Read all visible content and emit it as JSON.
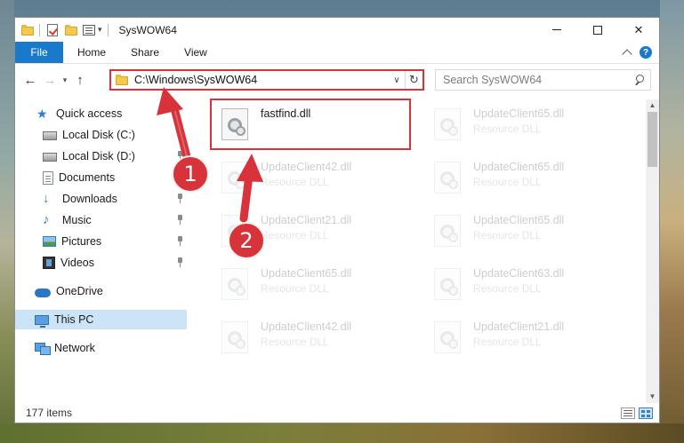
{
  "window": {
    "title": "SysWOW64",
    "qa_dropdown_glyph": "▾",
    "minimize_icon": "minimize-icon",
    "maximize_icon": "maximize-icon",
    "close_glyph": "✕"
  },
  "ribbon": {
    "tabs": [
      "File",
      "Home",
      "Share",
      "View"
    ],
    "help_glyph": "?"
  },
  "nav": {
    "back_glyph": "←",
    "forward_glyph": "→",
    "recent_glyph": "▾",
    "up_glyph": "↑",
    "address": "C:\\Windows\\SysWOW64",
    "address_drop_glyph": "∨",
    "refresh_glyph": "↻",
    "search_placeholder": "Search SysWOW64"
  },
  "sidebar": {
    "items": [
      {
        "label": "Quick access",
        "icon": "star-icon",
        "glyph": "★"
      },
      {
        "label": "Local Disk (C:)",
        "icon": "drive-icon"
      },
      {
        "label": "Local Disk (D:)",
        "icon": "drive-icon"
      },
      {
        "label": "Documents",
        "icon": "documents-icon"
      },
      {
        "label": "Downloads",
        "icon": "downloads-icon",
        "glyph": "↓"
      },
      {
        "label": "Music",
        "icon": "music-icon",
        "glyph": "♪"
      },
      {
        "label": "Pictures",
        "icon": "pictures-icon"
      },
      {
        "label": "Videos",
        "icon": "videos-icon"
      },
      {
        "label": "OneDrive",
        "icon": "onedrive-icon"
      },
      {
        "label": "This PC",
        "icon": "this-pc-icon"
      },
      {
        "label": "Network",
        "icon": "network-icon"
      }
    ]
  },
  "files": [
    {
      "name": "fastfind.dll",
      "type": ""
    },
    {
      "name": "UpdateClient65.dll",
      "type": "Resource DLL"
    },
    {
      "name": "UpdateClient42.dll",
      "type": "Resource DLL"
    },
    {
      "name": "UpdateClient65.dll",
      "type": "Resource DLL"
    },
    {
      "name": "UpdateClient21.dll",
      "type": "Resource DLL"
    },
    {
      "name": "UpdateClient65.dll",
      "type": "Resource DLL"
    },
    {
      "name": "UpdateClient65.dll",
      "type": "Resource DLL"
    },
    {
      "name": "UpdateClient63.dll",
      "type": "Resource DLL"
    },
    {
      "name": "UpdateClient42.dll",
      "type": "Resource DLL"
    },
    {
      "name": "UpdateClient21.dll",
      "type": "Resource DLL"
    }
  ],
  "status": {
    "item_count": "177 items"
  },
  "annotations": {
    "step1": "1",
    "step2": "2",
    "color": "#d8333a"
  }
}
